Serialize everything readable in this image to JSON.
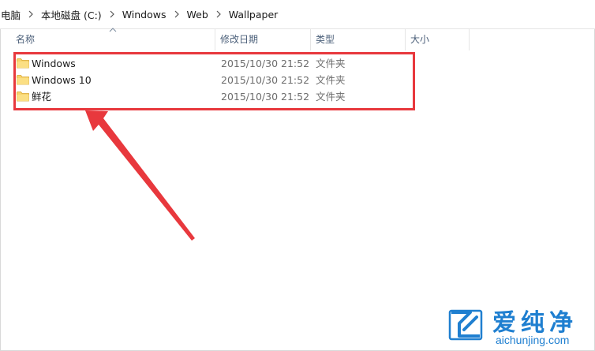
{
  "breadcrumb": {
    "items": [
      "电脑",
      "本地磁盘 (C:)",
      "Windows",
      "Web",
      "Wallpaper"
    ]
  },
  "columns": {
    "name": "名称",
    "date": "修改日期",
    "type": "类型",
    "size": "大小"
  },
  "files": [
    {
      "name": "Windows",
      "date": "2015/10/30 21:52",
      "type": "文件夹",
      "icon": "folder-icon"
    },
    {
      "name": "Windows 10",
      "date": "2015/10/30 21:52",
      "type": "文件夹",
      "icon": "folder-icon"
    },
    {
      "name": "鲜花",
      "date": "2015/10/30 21:52",
      "type": "文件夹",
      "icon": "folder-icon"
    }
  ],
  "watermark": {
    "title": "爱纯净",
    "url": "aichunjing.com"
  },
  "colors": {
    "highlight": "#e8383d",
    "folder": "#f7d36b",
    "watermark": "#1f7fd0",
    "header_text": "#4c607a"
  }
}
